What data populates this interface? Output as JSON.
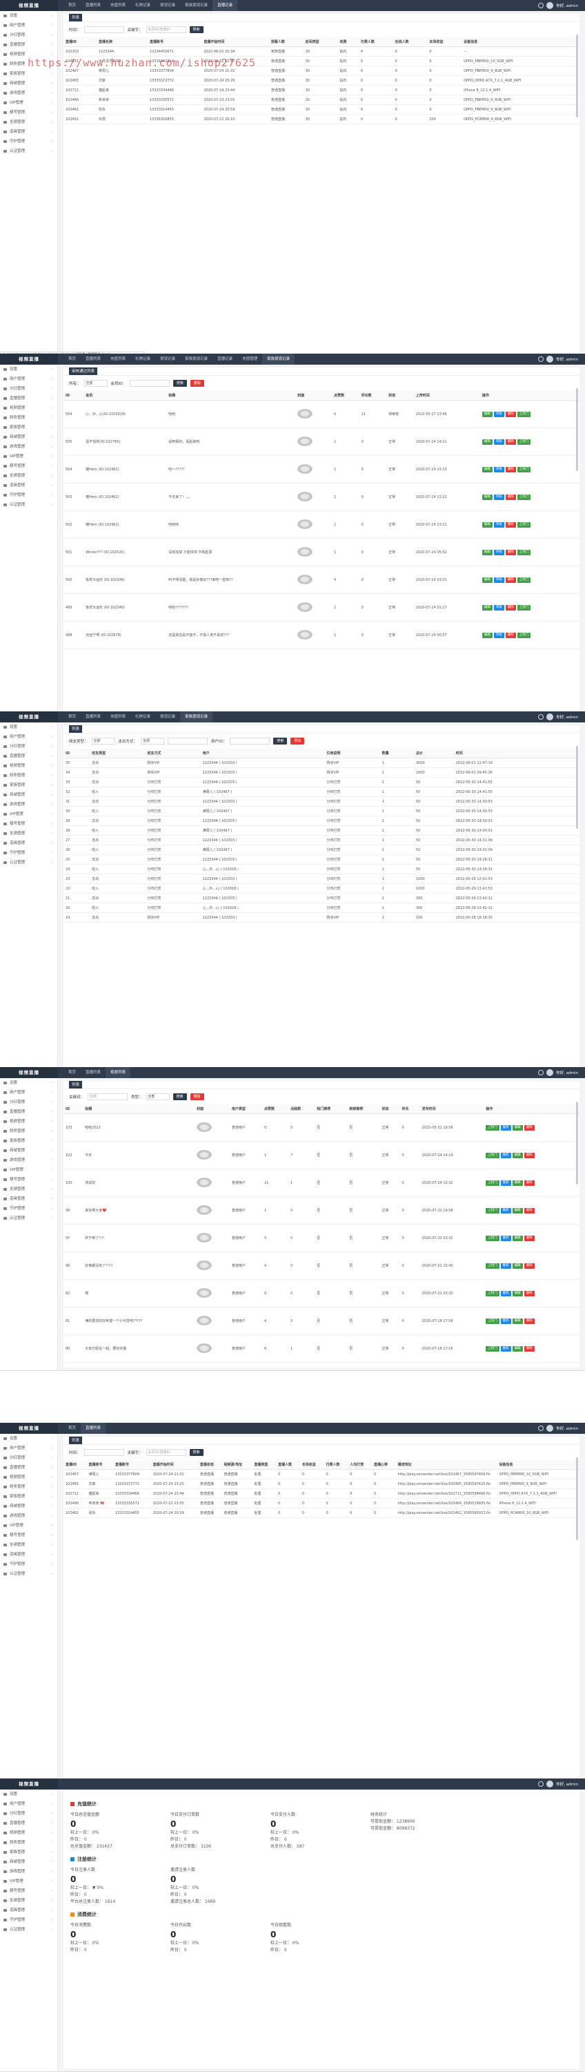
{
  "app": {
    "logo": "视频直播",
    "user": "你好, admin"
  },
  "sidebar": [
    {
      "label": "设置",
      "car": "›"
    },
    {
      "label": "用户管理",
      "car": "›"
    },
    {
      "label": "分红管理",
      "car": "›"
    },
    {
      "label": "直播管理",
      "car": "›"
    },
    {
      "label": "视频管理",
      "car": "›"
    },
    {
      "label": "财务管理",
      "car": "›"
    },
    {
      "label": "家族管理",
      "car": "›"
    },
    {
      "label": "商城管理",
      "car": "›"
    },
    {
      "label": "游戏管理",
      "car": "›"
    },
    {
      "label": "VIP管理",
      "car": "›"
    },
    {
      "label": "靓号管理",
      "car": "›"
    },
    {
      "label": "坐骑管理",
      "car": "›"
    },
    {
      "label": "道具管理",
      "car": "›"
    },
    {
      "label": "守护管理",
      "car": "›"
    },
    {
      "label": "认证管理",
      "car": "›"
    }
  ],
  "s1": {
    "tabs": [
      "首页",
      "直播列表",
      "充值列表",
      "礼物记录",
      "提现记录",
      "家族提现记录",
      "直播记录"
    ],
    "crumbs": [
      "列表"
    ],
    "filters": {
      "label1": "时间：",
      "label2": "关键字：",
      "placeholder": "会员ID/直播ID",
      "btn": "搜索"
    },
    "head": [
      "直播ID",
      "直播名称",
      "直播账号",
      "直播开始时间",
      "观看人数",
      "房间类型",
      "收费",
      "付费人数",
      "在线人数",
      "本场收益",
      "设备信息"
    ],
    "rows": [
      [
        "102303",
        "1223344",
        "12234455671",
        "2022-06-02 15:34",
        "家族直播",
        "30",
        "钻石",
        "0",
        "0",
        "0",
        "--"
      ],
      [
        "104831",
        "水月清宁1068",
        "13314442314",
        "2022-05-31 15:47",
        "普通直播",
        "30",
        "钻石",
        "0",
        "0",
        "0",
        "OPPO_PBEM00_10_5GB_WIFI"
      ],
      [
        "102467",
        "蒋周儿",
        "13333377804",
        "2020-07-24 21:32",
        "普通直播",
        "30",
        "钻石",
        "0",
        "0",
        "0",
        "OPPO_PBEM00_9_8GB_WIFI"
      ],
      [
        "102465",
        "刘家",
        "13333372772",
        "2020-07-24 23:26",
        "普通直播",
        "30",
        "钻石",
        "0",
        "0",
        "0",
        "OPPO_OPPO A7X_7.1.1_4GB_WIFI"
      ],
      [
        "102712",
        "猫起来",
        "13333334466",
        "2020-07-24 23:44",
        "普通直播",
        "30",
        "钻石",
        "0",
        "0",
        "0",
        "iPhone 8_12.1.4_WIFI"
      ],
      [
        "102466",
        "希亲亲",
        "13333335571",
        "2020-07-23 23:55",
        "普通直播",
        "30",
        "钻石",
        "0",
        "0",
        "0",
        "OPPO_PBEM00_9_8GB_WIFI"
      ],
      [
        "102462",
        "张永",
        "13333314455",
        "2020-07-24 20:59",
        "普通直播",
        "30",
        "钻石",
        "0",
        "0",
        "0",
        "OPPO_PBEM00_9_8GB_WIFI"
      ],
      [
        "102452",
        "石周",
        "13336316855",
        "2020-07-22 20:10",
        "普通直播",
        "30",
        "钻石",
        "0",
        "0",
        "200",
        "OPPO_PCAM00_9_8GB_WIFI"
      ]
    ],
    "watermark": "https://www.huzhan.com/ishop27625",
    "status": "javascript:openapp('/admin.php/index/index','',该信息','直播列表',true);"
  },
  "s2": {
    "tabs": [
      "首页",
      "直播列表",
      "充值列表",
      "礼物记录",
      "提现记录",
      "家族提现记录",
      "直播记录",
      "充值管理",
      "家族提现记录"
    ],
    "crumbs": [
      "审核通过列表"
    ],
    "filters": {
      "label1": "所有：",
      "sel1": "全部",
      "label2": "会员ID：",
      "placeholder": "",
      "btn": "搜索",
      "btn2": "删除"
    },
    "head": [
      "ID",
      "会员",
      "标题",
      "封面",
      "点赞数",
      "评论数",
      "状态",
      "上传时间",
      "操作"
    ],
    "rows": [
      [
        "504",
        "心...外...心(ID:1102918)",
        "哈哈",
        "",
        "0",
        "11",
        "待审核",
        "2022-05-27 13:46"
      ],
      [
        "505",
        "蛋不怕你(ID:102765)",
        "说到我的，看起来吧",
        "",
        "1",
        "0",
        "正常",
        "2020-07-24 14:11"
      ],
      [
        "504",
        "瘦Hem (ID:102462)",
        "哈～?????",
        "",
        "1",
        "0",
        "正常",
        "2020-07-24 13:33"
      ],
      [
        "503",
        "瘦Hem (ID:102462)",
        "今天来了！。。。",
        "",
        "1",
        "0",
        "正常",
        "2020-07-24 13:22"
      ],
      [
        "502",
        "瘦Hem (ID:102462)",
        "哈哈哈",
        "",
        "1",
        "0",
        "正常",
        "2020-07-24 13:21"
      ],
      [
        "501",
        "Winter??? (ID:102520)",
        "没有完成 才能体现 平和起源",
        "",
        "1",
        "0",
        "正常",
        "2020-07-24 05:52"
      ],
      [
        "500",
        "象样大远红 (ID:102348)",
        "听不明清楚，我是好像好???来吧一直到??",
        "",
        "4",
        "0",
        "正常",
        "2020-07-24 03:01"
      ],
      [
        "499",
        "象样大远红 (ID:102348)",
        "哈哈???????",
        "",
        "1",
        "0",
        "正常",
        "2020-07-24 01:27"
      ],
      [
        "498",
        "迈远宁啊 (ID:102678)",
        "还是我还是不能不，不需人类不喜欢???",
        "",
        "1",
        "0",
        "正常",
        "2020-07-24 00:57"
      ]
    ]
  },
  "s3": {
    "tabs": [
      "首页",
      "直播列表",
      "充值列表",
      "礼物记录",
      "提现记录",
      "家族提现记录"
    ],
    "crumbs": [
      "列表"
    ],
    "filters": {
      "label1": "收支类型：",
      "sel1": "全部",
      "label2": "支出方式：",
      "sel2": "全部",
      "label3": "用户ID：",
      "btn": "搜索",
      "btn2": "导出"
    },
    "head": [
      "ID",
      "收支类型",
      "收支方式",
      "用户",
      "引用说明",
      "数量",
      "总价",
      "时间"
    ],
    "rows": [
      [
        "35",
        "支出",
        "购买VIP",
        "1223344 ( 102303 )",
        "购买VIP",
        "1",
        "3000",
        "2022-06-01 11:47:19"
      ],
      [
        "34",
        "支出",
        "购买VIP",
        "1223344 ( 102303 )",
        "购买VIP",
        "1",
        "2000",
        "2022-06-01 09:45:26"
      ],
      [
        "33",
        "支出",
        "分布打赏",
        "1223344 ( 102303 )",
        "分布打赏",
        "1",
        "50",
        "2022-05-30 14:41:55"
      ],
      [
        "32",
        "收入",
        "分布打赏",
        "满周儿 ( 102467 )",
        "分布打赏",
        "1",
        "50",
        "2022-05-30 14:41:55"
      ],
      [
        "31",
        "支出",
        "分布打赏",
        "1223344 ( 102303 )",
        "分布打赏",
        "1",
        "50",
        "2022-05-30 14:30:53"
      ],
      [
        "30",
        "收入",
        "分布打赏",
        "满周儿 ( 102467 )",
        "分布打赏",
        "1",
        "50",
        "2022-05-30 14:30:53"
      ],
      [
        "29",
        "支出",
        "分布打赏",
        "1223344 ( 102303 )",
        "分布打赏",
        "1",
        "50",
        "2022-05-30 14:30:01"
      ],
      [
        "28",
        "收入",
        "分布打赏",
        "满周儿 ( 102467 )",
        "分布打赏",
        "1",
        "50",
        "2022-05-30 14:30:01"
      ],
      [
        "27",
        "支出",
        "分布打赏",
        "1223344 ( 102303 )",
        "分布打赏",
        "1",
        "50",
        "2022-05-30 14:31:09"
      ],
      [
        "26",
        "收入",
        "分布打赏",
        "满周儿 ( 102467 )",
        "分布打赏",
        "1",
        "50",
        "2022-05-30 14:31:09"
      ],
      [
        "25",
        "支出",
        "分布打赏",
        "1223344 ( 102303 )",
        "分布打赏",
        "1",
        "50",
        "2022-05-30 14:28:31"
      ],
      [
        "24",
        "收入",
        "分布打赏",
        "心...外...心 ( 102918 )",
        "分布打赏",
        "1",
        "50",
        "2022-05-30 14:28:31"
      ],
      [
        "23",
        "支出",
        "分布打赏",
        "1223344 ( 102303 )",
        "分布打赏",
        "1",
        "1000",
        "2022-05-29 13:42:53"
      ],
      [
        "22",
        "收入",
        "分布打赏",
        "心...外...心 ( 102918 )",
        "分布打赏",
        "1",
        "1000",
        "2022-05-29 13:42:53"
      ],
      [
        "21",
        "支出",
        "分布打赏",
        "1223344 ( 102303 )",
        "分布打赏",
        "1",
        "300",
        "2022-05-29 13:42:12"
      ],
      [
        "20",
        "收入",
        "分布打赏",
        "心...外...心 ( 102918 )",
        "分布打赏",
        "1",
        "300",
        "2022-05-29 13:42:12"
      ],
      [
        "19",
        "支出",
        "购买VIP",
        "1223344 ( 102303 )",
        "购买VIP",
        "1",
        "100",
        "2022-05-28 18:18:35"
      ]
    ]
  },
  "s4": {
    "tabs": [
      "首页",
      "直播列表",
      "视频列表"
    ],
    "crumbs": [
      "列表"
    ],
    "filters": {
      "label1": "关键词：",
      "placeholder": "标题",
      "label2": "类型：",
      "sel1": "全部",
      "btn": "搜索",
      "btn2": "删除"
    },
    "head": [
      "ID",
      "标题",
      "封面",
      "用户类型",
      "点赞数",
      "点踩数",
      "热门推荐",
      "新鲜推荐",
      "状态",
      "时长",
      "发布时间",
      "操作"
    ],
    "rows": [
      [
        "103",
        "哈哈2022",
        "",
        "普通用户",
        "0",
        "0",
        "否",
        "否",
        "正常",
        "0",
        "2022-05-31 19:58"
      ],
      [
        "102",
        "今天",
        "",
        "普通用户",
        "1",
        "7",
        "否",
        "否",
        "正常",
        "0",
        "2020-07-24 14:19"
      ],
      [
        "100",
        "测试的",
        "",
        "普通用户",
        "21",
        "1",
        "否",
        "否",
        "正常",
        "0",
        "2020-07-24 13:32"
      ],
      [
        "99",
        "来玩啊大家❤️",
        "",
        "普通用户",
        "1",
        "0",
        "否",
        "否",
        "正常",
        "0",
        "2020-07-22 19:58"
      ],
      [
        "97",
        "终于到了!!!!",
        "",
        "普通用户",
        "5",
        "0",
        "否",
        "否",
        "正常",
        "0",
        "2020-07-22 03:32"
      ],
      [
        "96",
        "好像都没有了!!!!!",
        "",
        "普通用户",
        "4",
        "0",
        "否",
        "否",
        "正常",
        "0",
        "2020-07-21 23:40"
      ],
      [
        "82",
        "嗯",
        "",
        "普通用户",
        "0",
        "0",
        "否",
        "否",
        "正常",
        "0",
        "2020-07-21 03:30"
      ],
      [
        "81",
        "满的要求好好希望一个小可爱吧?????",
        "",
        "普通用户",
        "4",
        "0",
        "否",
        "否",
        "正常",
        "0",
        "2020-07-18 17:58"
      ],
      [
        "80",
        "大家已经在一起，要好好做",
        "",
        "普通用户",
        "6",
        "1",
        "否",
        "否",
        "正常",
        "0",
        "2020-07-18 17:15"
      ]
    ]
  },
  "s5": {
    "tabs": [
      "首页",
      "直播列表"
    ],
    "crumbs": [
      "列表"
    ],
    "filters": {
      "label1": "时间：",
      "label2": "关键字：",
      "placeholder": "会员ID/直播ID",
      "btn": "搜索"
    },
    "head": [
      "直播ID",
      "直播账号",
      "直播账号",
      "直播开始时间",
      "直播状态",
      "视频源/地址",
      "直播类型",
      "直播人数",
      "本场收益",
      "付费人数",
      "人均打赏",
      "直播心率",
      "播流地址",
      "设备信息"
    ],
    "rows": [
      [
        "102467",
        "满周儿",
        "13333377804",
        "2020-07-24 21:31",
        "普通直播",
        "普通直播",
        "处理",
        "0",
        "0",
        "0",
        "0",
        "0",
        "http://play.xmsender.net/live/102467_1595597404.flv",
        "OPPO_PBEM00_10_5GB_WIFI"
      ],
      [
        "102465",
        "刘家",
        "13333372772",
        "2020-07-24 23:25",
        "普通直播",
        "普通直播",
        "处理",
        "0",
        "0",
        "0",
        "0",
        "0",
        "http://play.xmsender.net/live/102465_1595597423.flv",
        "OPPO_PBEM00_9_8GB_WIFI"
      ],
      [
        "102712",
        "猫起来",
        "13333334466",
        "2020-07-24 23:44",
        "普通直播",
        "普通直播",
        "处理",
        "0",
        "0",
        "0",
        "0",
        "0",
        "http://play.xmsender.net/live/102712_1595598466.flv",
        "OPPO_OPPO A7X_7.1.1_4GB_WIFI"
      ],
      [
        "102466",
        "希亲亲 🎀",
        "13333335571",
        "2020-07-23 23:55",
        "普通直播",
        "普通直播",
        "处理",
        "0",
        "0",
        "0",
        "0",
        "0",
        "http://play.xmsender.net/live/102466_1595519935.flv",
        "iPhone 8_12.1.4_WIFI"
      ],
      [
        "102462",
        "张永",
        "13333314455",
        "2020-07-24 20:59",
        "普通直播",
        "普通直播",
        "处理",
        "0",
        "0",
        "0",
        "0",
        "0",
        "http://play.xmsender.net/live/102462_1595595913.flv",
        "OPPO_PCAM00_10_8GB_WIFI"
      ]
    ]
  },
  "s6": {
    "sections": [
      {
        "title": "充值统计",
        "icon": "red",
        "cols": [
          {
            "k": "今日总充值金额",
            "v": "0",
            "a": "较上一日：  0%",
            "b": "昨日：  0",
            "c": "总充值金额：  231637"
          },
          {
            "k": "今日支付订单数",
            "v": "0",
            "a": "较上一日：  0%",
            "b": "昨日：  0",
            "c": "总支付订单数：  3236"
          },
          {
            "k": "今日支付人数",
            "v": "0",
            "a": "较上一日：  0%",
            "b": "昨日：  0",
            "c": "总支付人数：  587"
          },
          {
            "k": "财务统计",
            "v": "",
            "a": "可提现金额：  1238900",
            "b": "可提现金额：  8098372",
            "c": ""
          }
        ]
      },
      {
        "title": "注册统计",
        "icon": "blue",
        "cols": [
          {
            "k": "今日注册人数",
            "v": "0",
            "a": "较上一日：  ▼ 0%",
            "b": "昨日：  0",
            "c": "平台总注册人数：  1914"
          },
          {
            "k": "邀请注册人数",
            "v": "0",
            "a": "较上一日：  0%",
            "b": "昨日：  0",
            "c": "邀请注册总人数：  1669"
          }
        ]
      },
      {
        "title": "消费统计",
        "icon": "orange",
        "cols": [
          {
            "k": "今日消费数",
            "v": "0",
            "a": "较上一日：  0%",
            "b": "昨日：  0",
            "c": ""
          },
          {
            "k": "今日开启数",
            "v": "0",
            "a": "较上一日：  0%",
            "b": "昨日：  0",
            "c": ""
          },
          {
            "k": "今日观看数",
            "v": "0",
            "a": "较上一日：  0%",
            "b": "昨日：  0",
            "c": ""
          }
        ]
      }
    ]
  },
  "actions": {
    "a1": "下播",
    "a2": "禁播",
    "a3": "删除",
    "a4": "修改",
    "a5": "编辑",
    "a6": "审核",
    "a7": "上热门",
    "a8": "下热门",
    "a9": "推荐"
  }
}
